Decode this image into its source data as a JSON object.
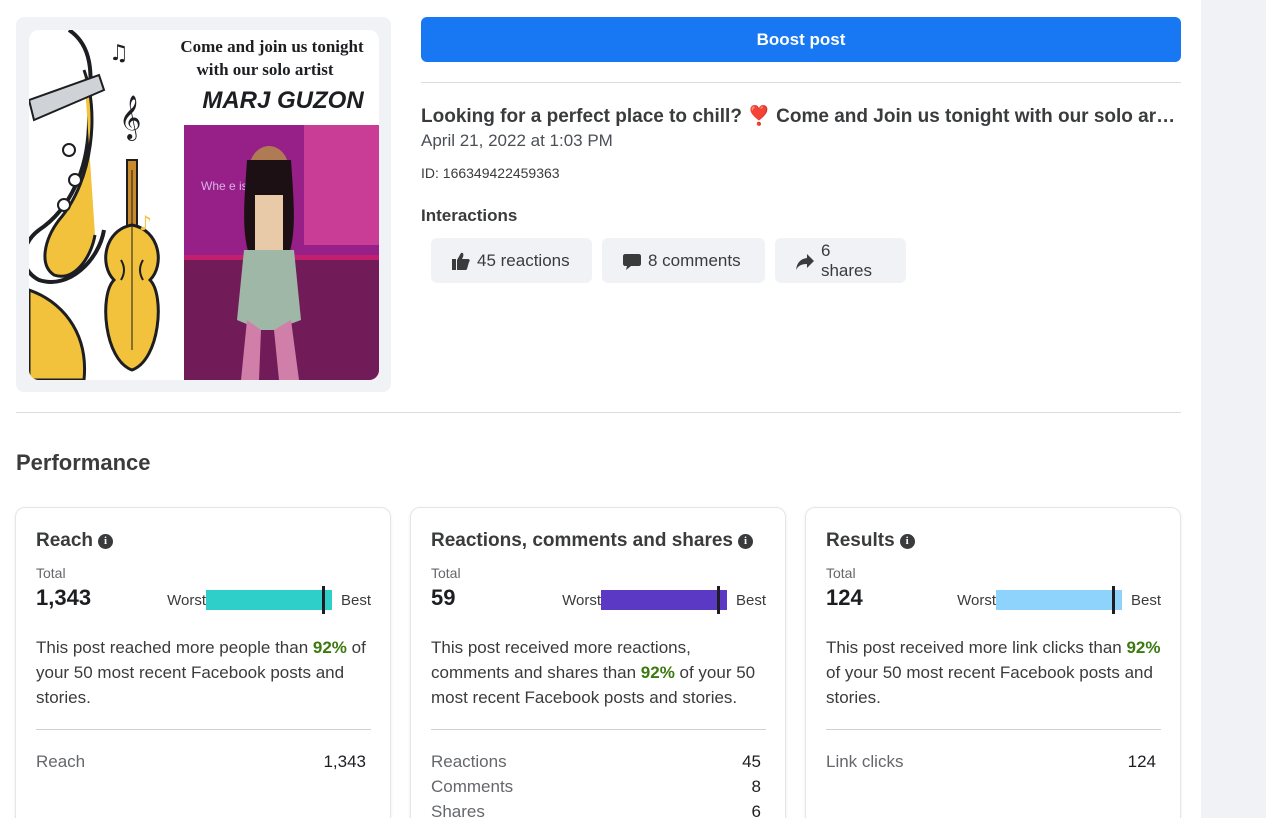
{
  "colors": {
    "primary_button": "#1877f2",
    "reach_bar": "#2ecfc9",
    "engagement_bar": "#5c39c5",
    "results_bar": "#8dd3fb",
    "positive_percent": "#3b7a10"
  },
  "poster": {
    "line1": "Come and join us tonight",
    "line2": "with our solo artist",
    "artist": "MARJ GUZON",
    "sign_text": "Whe        e is you"
  },
  "boost_button": {
    "label": "Boost post"
  },
  "post": {
    "title": "Looking for a perfect place to chill? ❣️ Come and Join us tonight with our solo artist Marj Guzon",
    "date": "April 21, 2022 at 1:03 PM",
    "id": "ID: 166349422459363"
  },
  "interactions": {
    "label": "Interactions",
    "reactions": "45 reactions",
    "comments": "8 comments",
    "shares": "6 shares"
  },
  "performance": {
    "heading": "Performance",
    "cards": [
      {
        "title": "Reach",
        "total_label": "Total",
        "total": "1,343",
        "worst": "Worst",
        "best": "Best",
        "bar_level": 0.92,
        "desc_before": "This post reached more people than ",
        "percent": "92%",
        "desc_after": " of your 50 most recent Facebook posts and stories.",
        "rows": [
          {
            "label": "Reach",
            "value": "1,343"
          }
        ]
      },
      {
        "title": "Reactions, comments and shares",
        "total_label": "Total",
        "total": "59",
        "worst": "Worst",
        "best": "Best",
        "bar_level": 0.92,
        "desc_before": "This post received more reactions, comments and shares than ",
        "percent": "92%",
        "desc_after": " of your 50 most recent Facebook posts and stories.",
        "rows": [
          {
            "label": "Reactions",
            "value": "45"
          },
          {
            "label": "Comments",
            "value": "8"
          },
          {
            "label": "Shares",
            "value": "6"
          }
        ]
      },
      {
        "title": "Results",
        "total_label": "Total",
        "total": "124",
        "worst": "Worst",
        "best": "Best",
        "bar_level": 0.92,
        "desc_before": "This post received more link clicks than ",
        "percent": "92%",
        "desc_after": " of your 50 most recent Facebook posts and stories.",
        "rows": [
          {
            "label": "Link clicks",
            "value": "124"
          }
        ]
      }
    ]
  }
}
